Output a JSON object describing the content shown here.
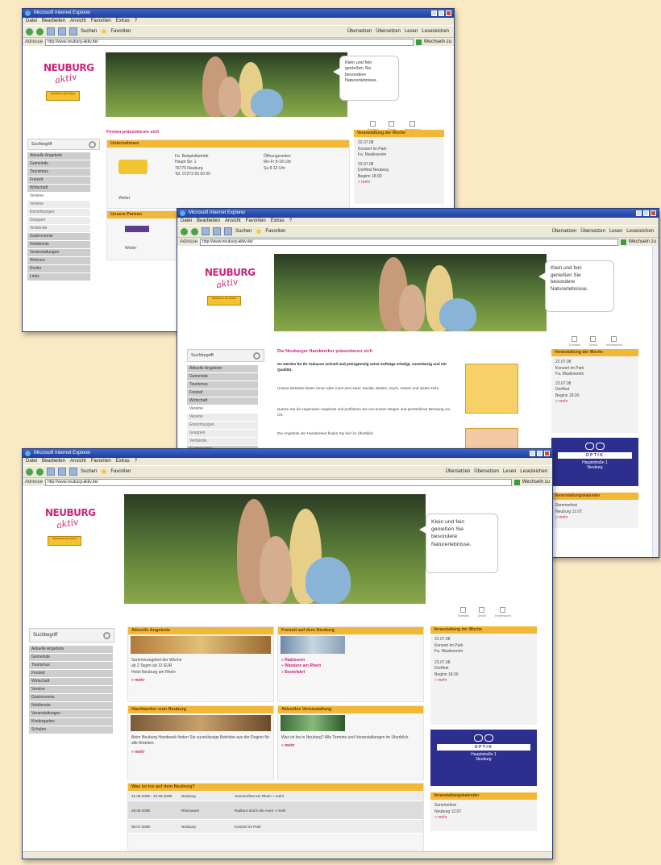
{
  "browser": {
    "title": "Microsoft Internet Explorer",
    "menu": [
      "Datei",
      "Bearbeiten",
      "Ansicht",
      "Favoriten",
      "Extras",
      "?"
    ],
    "toolbar": {
      "back": "Zurück",
      "search": "Suchen",
      "favorites": "Favoriten"
    },
    "toolbar_right": [
      "Übersetzen",
      "Übersetzen",
      "Lesen",
      "Lesezeichen"
    ],
    "address_label": "Adresse",
    "address_value": "http://www.neuburg-aktiv.de/",
    "go": "Wechseln zu",
    "links": "Links"
  },
  "site": {
    "logo_word1": "NEUBURG",
    "logo_word2": "aktiv",
    "logo_plate": "NEUBURG AM RHEIN",
    "hero_bubble": "Klein und fein\ngenießen Sie\nbesondere\nNaturerlebnisse.",
    "utility": [
      "Kontakt",
      "Druck",
      "Impressum"
    ],
    "search_label": "Suchbegriff",
    "nav": [
      "Aktuelle Angebote",
      "Gemeinde",
      "Tourismus",
      "Freizeit",
      "Wirtschaft",
      "Vereine",
      "Gastronomie",
      "Notdienste",
      "Veranstaltungen",
      "Kindergarten",
      "Schulen"
    ],
    "nav_back": [
      "Aktuelle Angebote",
      "Gemeinde",
      "Tourismus",
      "Freizeit",
      "Wirtschaft",
      "Vereine"
    ],
    "nav_back_sub": [
      "Vereine",
      "Einrichtungen",
      "Gruppen",
      "Verbände"
    ],
    "nav_back2": [
      "Gastronomie",
      "Notdienste",
      "Veranstaltungen",
      "Wohnen",
      "Kinder",
      "Links"
    ]
  },
  "win1": {
    "page_title": "Firmen präsentieren sich",
    "box1_header": "Unternehmen",
    "box1_text": "Fa. Beispielbetrieb\nHaupt Str. 1\n76776 Neuburg\nTel. 07273 00 00 00",
    "box1_text2": "Öffnungszeiten\nMo-Fr 8-18 Uhr\nSa 8-12 Uhr",
    "box1_more": "Weiter",
    "box2_header": "Unsere Partner",
    "box2_more": "Weiter",
    "right_header": "Veranstaltung der Woche",
    "right_items": [
      "22.07.08\nKonzert im Park\nFa. Musikverein",
      "23.07.08\nDorffest Neuburg\nBeginn 18.00"
    ],
    "right_more": "» mehr"
  },
  "win2": {
    "page_title": "Die Neuburger Handwerker präsentieren sich",
    "intro": "So werden für Ihr Zuhause schnell und preisgünstig seine Aufträge erledigt, zuverlässig und mit Qualität.",
    "para1": "Unsere Betriebe bieten Ihnen alles rund ums Haus: Sanitär, Elektro, Dach, Garten und vieles mehr.",
    "para2": "Nutzen Sie die regionalen Angebote und profitieren Sie von kurzen Wegen und persönlicher Beratung vor Ort.",
    "para3": "Die Angebote der Handwerker finden Sie hier im Überblick.",
    "right_header": "Veranstaltung der Woche",
    "right_items": [
      "22.07.08\nKonzert im Park\nFa. Musikverein",
      "23.07.08\nDorffest\nBeginn 18.00"
    ],
    "right_more": "» mehr",
    "optik_brand": "OPTIK",
    "optik_text": "Hauptstraße 1\nNeuburg",
    "right2_header": "Veranstaltungskalender",
    "right2_text": "Sommerfest\nNeuburg 12.07.",
    "right2_more": "» mehr"
  },
  "win3": {
    "box1_header": "Aktuelle Angebote",
    "box1_text": "Sommerangebot der Woche\nab 2 Tagen ab 12 EUR\nHotel Neuburg am Rhein",
    "box1_more": "» mehr",
    "box2_header": "Freizeit auf dem Neuburg",
    "box2_items": [
      "» Radtouren",
      "» Wandern am Rhein",
      "» Bootsfahrt"
    ],
    "box3_header": "Handwerker zum Neuburg",
    "box3_text": "Beim Neuburg Handwerk finden Sie zuverlässige Betriebe aus der Region für alle Arbeiten.",
    "box3_more": "» mehr",
    "box4_header": "Aktuelles Veranstaltung",
    "box4_text": "Was ist los in Neuburg? Alle Termine und Veranstaltungen im Überblick.",
    "box4_more": "» mehr",
    "table_header": "Was ist los auf dem Neuburg?",
    "table_rows": [
      [
        "21.06.2008 - 22.06.2008",
        "Neuburg",
        "Sommerfest am Rhein » mehr"
      ],
      [
        "28.06.2008",
        "Rheinauen",
        "Radtour durch die Auen » mehr"
      ],
      [
        "05.07.2008",
        "Neuburg",
        "Konzert im Park"
      ]
    ],
    "right_header": "Veranstaltung der Woche",
    "right_items": [
      "22.07.08\nKonzert im Park\nFa. Musikverein",
      "23.07.08\nDorffest\nBeginn 18.00"
    ],
    "right_more": "» mehr",
    "optik_brand": "OPTIK",
    "optik_text": "Hauptstraße 1\nNeuburg",
    "right2_header": "Veranstaltungskalender",
    "right2_text": "Sommerfest\nNeuburg 12.07.",
    "right2_more": "» mehr"
  }
}
